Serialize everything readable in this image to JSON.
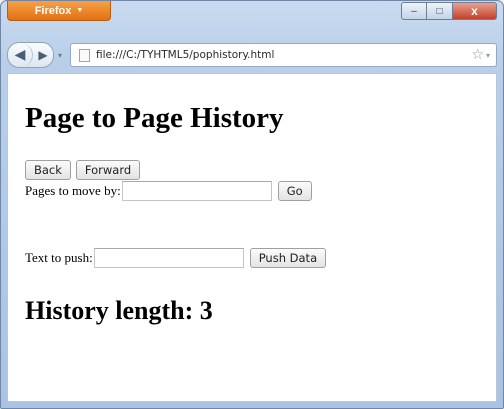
{
  "browser": {
    "menu_button_label": "Firefox",
    "menu_caret": "▼",
    "window_controls": {
      "minimize": "–",
      "maximize": "□",
      "close": "x"
    },
    "nav": {
      "back_glyph": "◀",
      "forward_glyph": "▶",
      "history_dropdown": "▾"
    },
    "address": "file:///C:/TYHTML5/pophistory.html",
    "bookmark_star": "☆",
    "url_dropdown": "▾"
  },
  "page": {
    "title": "Page to Page History",
    "back_label": "Back",
    "forward_label": "Forward",
    "pages_label": "Pages to move by:",
    "pages_value": "",
    "go_label": "Go",
    "push_label": "Text to push:",
    "push_value": "",
    "push_button_label": "Push Data",
    "history_text": "History length: 3"
  },
  "colors": {
    "firefox_button": "#e27114",
    "window_frame": "#b9cfe9",
    "close_button": "#c2412a"
  }
}
